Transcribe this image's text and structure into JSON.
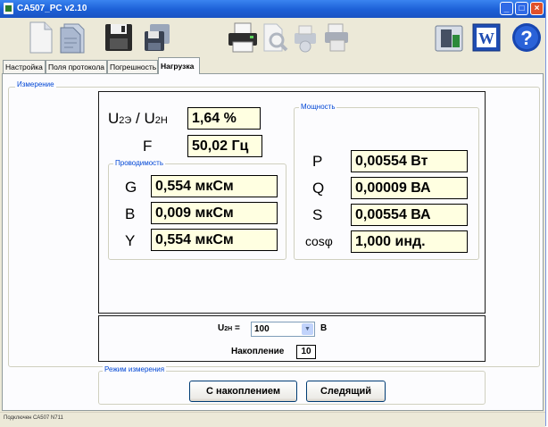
{
  "window": {
    "title": "CA507_PC v2.10",
    "min": "_",
    "max": "□",
    "close": "×"
  },
  "toolbar": {
    "buttons": [
      {
        "icon": "new-document-icon"
      },
      {
        "icon": "open-document-icon"
      },
      {
        "icon": "save-icon"
      },
      {
        "icon": "save-as-icon"
      },
      {
        "icon": "printer-icon"
      },
      {
        "icon": "print-preview-icon"
      },
      {
        "icon": "print-settings-icon"
      },
      {
        "icon": "printer-setup-icon"
      },
      {
        "icon": "connect-device-icon"
      },
      {
        "icon": "word-export-icon"
      },
      {
        "icon": "help-icon"
      }
    ],
    "word_letter": "W",
    "help_glyph": "?"
  },
  "tabs": [
    "Настройка",
    "Поля протокола",
    "Погрешность",
    "Нагрузка"
  ],
  "active_tab": "Нагрузка",
  "measurement": {
    "legend": "Измерение",
    "u_ratio": {
      "label_main": "U",
      "sub1": "2Э",
      "sep": " / U",
      "sub2": "2Н",
      "value": "1,64 %"
    },
    "f": {
      "label": "F",
      "value": "50,02 Гц"
    },
    "conductance": {
      "legend": "Проводимость",
      "rows": [
        {
          "label": "G",
          "value": "0,554 мкСм"
        },
        {
          "label": "B",
          "value": "0,009 мкСм"
        },
        {
          "label": "Y",
          "value": "0,554 мкСм"
        }
      ]
    },
    "power": {
      "legend": "Мощность",
      "rows": [
        {
          "label": "P",
          "value": "0,00554 Вт"
        },
        {
          "label": "Q",
          "value": "0,00009 ВА"
        },
        {
          "label": "S",
          "value": "0,00554 ВА"
        },
        {
          "label": "cosφ",
          "value": "1,000 инд."
        }
      ]
    }
  },
  "settings": {
    "u2n_label": "U",
    "u2n_sub": "2Н",
    "u2n_eq": " =",
    "u2n_value": "100",
    "u2n_unit": "В",
    "accum_label": "Накопление",
    "accum_value": "10"
  },
  "mode": {
    "legend": "Режим измерения",
    "btn_accum": "С накоплением",
    "btn_track": "Следящий"
  },
  "status": "Подключен СА507 N711"
}
